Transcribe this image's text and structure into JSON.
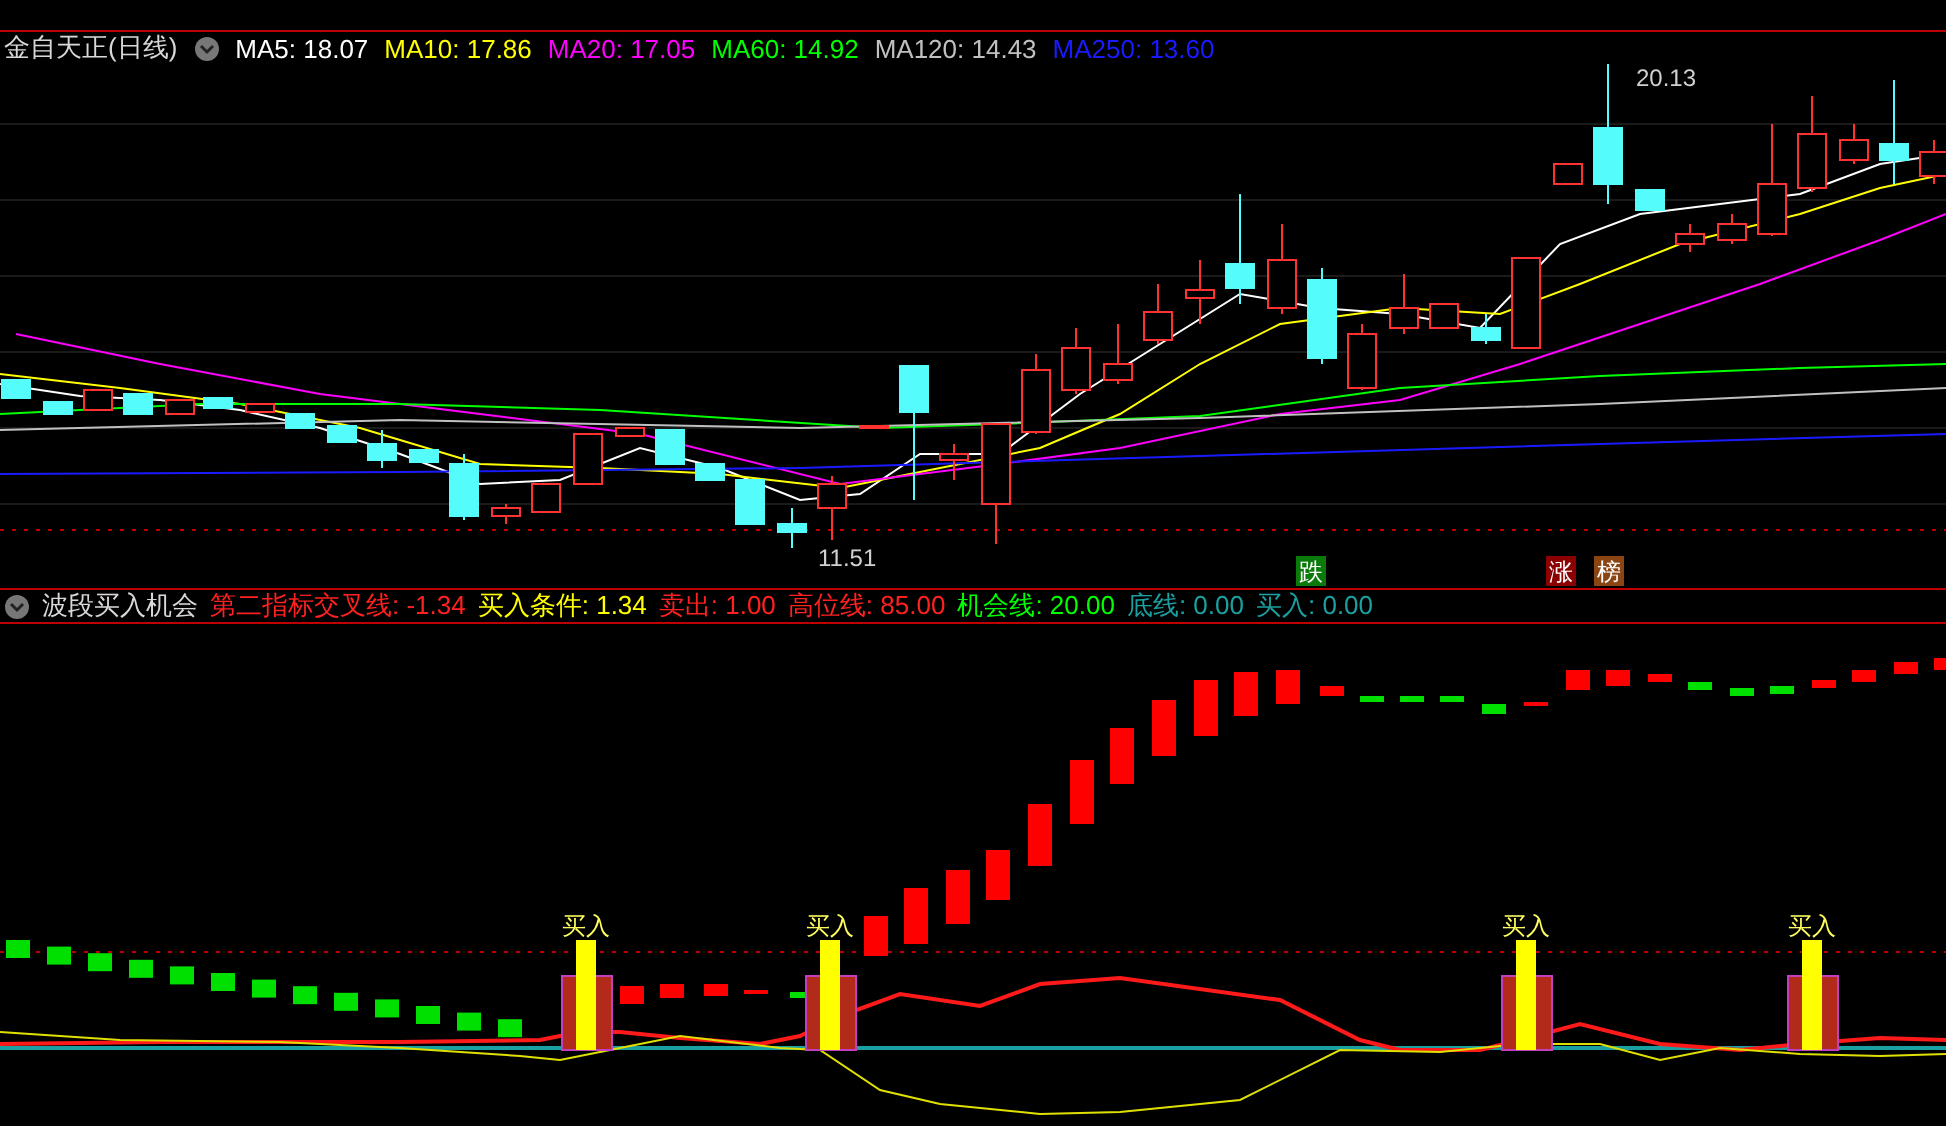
{
  "title": "金自天正(日线)",
  "ma_lines": [
    {
      "text": "MA5: 18.07",
      "color": "#ffffff"
    },
    {
      "text": "MA10: 17.86",
      "color": "#ffff00"
    },
    {
      "text": "MA20: 17.05",
      "color": "#ff00ff"
    },
    {
      "text": "MA60: 14.92",
      "color": "#00ff00"
    },
    {
      "text": "MA120: 14.43",
      "color": "#c0c0c0"
    },
    {
      "text": "MA250: 13.60",
      "color": "#1a1aff"
    }
  ],
  "price_marks": {
    "high": "20.13",
    "low": "11.51"
  },
  "badges": [
    {
      "text": "跌",
      "color": "#0a7a0a"
    },
    {
      "text": "涨",
      "color": "#8b0000"
    },
    {
      "text": "榜",
      "color": "#8b4513"
    }
  ],
  "indicator": {
    "name": "波段买入机会",
    "items": [
      {
        "text": "第二指标交叉线: -1.34",
        "color": "#ff2020"
      },
      {
        "text": "买入条件: 1.34",
        "color": "#ffff00"
      },
      {
        "text": "卖出: 1.00",
        "color": "#ff2020"
      },
      {
        "text": "高位线: 85.00",
        "color": "#ff2020"
      },
      {
        "text": "机会线: 20.00",
        "color": "#00ff00"
      },
      {
        "text": "底线: 0.00",
        "color": "#1aa0a0"
      },
      {
        "text": "买入: 0.00",
        "color": "#1aa0a0"
      }
    ]
  },
  "buy_signals": [
    "买入",
    "买入",
    "买入",
    "买入"
  ]
}
